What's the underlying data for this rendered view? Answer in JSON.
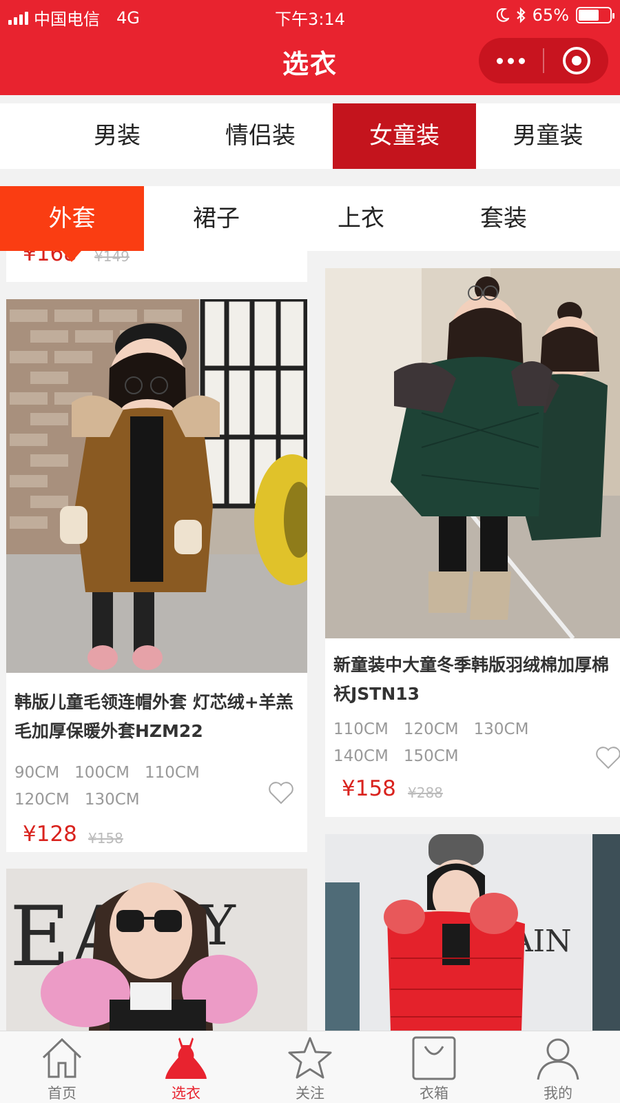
{
  "status_bar": {
    "carrier": "中国电信",
    "network": "4G",
    "time": "下午3:14",
    "battery": "65%",
    "battery_level": 0.65
  },
  "header": {
    "title": "选衣",
    "more_icon": "more-dots-icon",
    "close_icon": "target-circle-icon"
  },
  "category_tabs": [
    {
      "label": "男装",
      "active": false
    },
    {
      "label": "情侣装",
      "active": false
    },
    {
      "label": "女童装",
      "active": true
    },
    {
      "label": "男童装",
      "active": false
    }
  ],
  "sub_tabs": [
    {
      "label": "外套",
      "active": true
    },
    {
      "label": "裙子",
      "active": false
    },
    {
      "label": "上衣",
      "active": false
    },
    {
      "label": "套装",
      "active": false
    }
  ],
  "products": [
    {
      "name": "韩版儿童毛领连帽外套 灯芯绒+羊羔毛加厚保暖外套HZM22",
      "sizes": [
        "90CM",
        "100CM",
        "110CM",
        "120CM",
        "130CM"
      ],
      "price": "¥128",
      "old_price": "¥158"
    },
    {
      "name": "新童装中大童冬季韩版羽绒棉加厚棉袄JSTN13",
      "sizes": [
        "110CM",
        "120CM",
        "130CM",
        "140CM",
        "150CM"
      ],
      "price": "¥158",
      "old_price": "¥288"
    }
  ],
  "top_partial": {
    "price": "¥168",
    "old_price": "¥149"
  },
  "tabbar": [
    {
      "label": "首页",
      "icon": "home-icon",
      "active": false
    },
    {
      "label": "选衣",
      "icon": "dress-icon",
      "active": true
    },
    {
      "label": "关注",
      "icon": "star-icon",
      "active": false
    },
    {
      "label": "衣箱",
      "icon": "bag-icon",
      "active": false
    },
    {
      "label": "我的",
      "icon": "user-icon",
      "active": false
    }
  ],
  "colors": {
    "header": "#e8232f",
    "category_active": "#c4141d",
    "subtab_active": "#fa3d12",
    "price": "#d9231e"
  }
}
